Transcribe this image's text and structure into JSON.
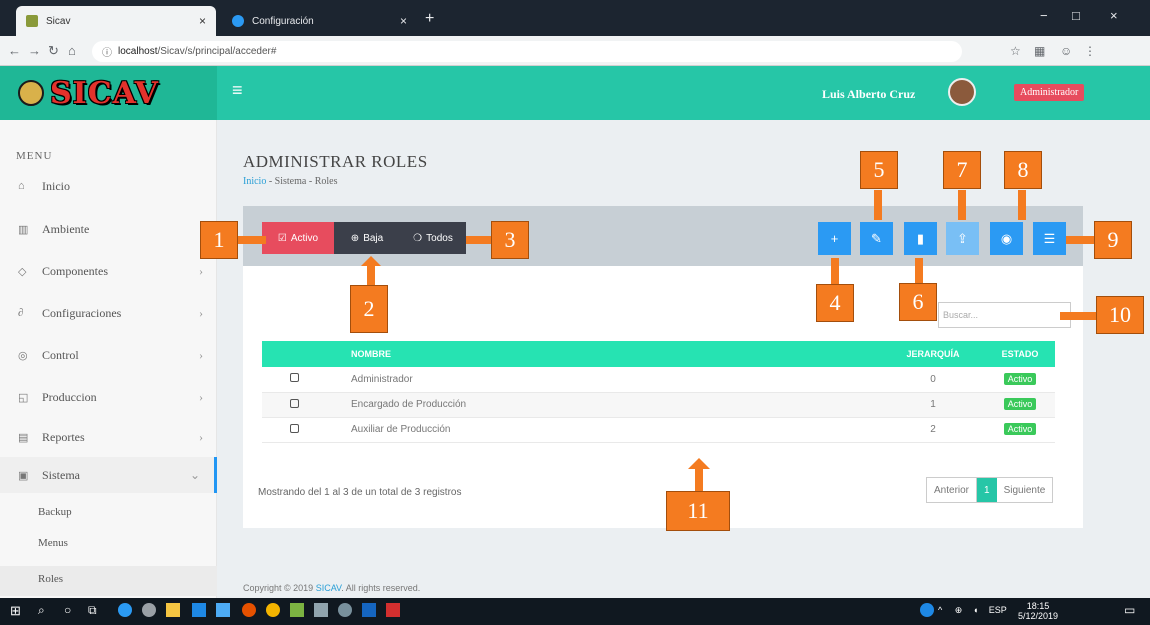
{
  "browser": {
    "tabs": [
      {
        "label": "Sicav",
        "close": "×"
      },
      {
        "label": "Configuración",
        "close": "×"
      }
    ],
    "new_tab": "+",
    "url_prefix": "localhost",
    "url_path": "/Sicav/s/principal/acceder#",
    "window_controls": [
      "−",
      "□",
      "×"
    ]
  },
  "app": {
    "logo_text": "SICAV",
    "user_name": "Luis Alberto Cruz",
    "user_role": "Administrador"
  },
  "sidebar": {
    "title": "MENU",
    "items": [
      {
        "label": "Inicio",
        "icon": "home-icon"
      },
      {
        "label": "Ambiente",
        "icon": "bank-icon"
      },
      {
        "label": "Componentes",
        "icon": "component-icon"
      },
      {
        "label": "Configuraciones",
        "icon": "config-icon"
      },
      {
        "label": "Control",
        "icon": "control-icon"
      },
      {
        "label": "Produccion",
        "icon": "production-icon"
      },
      {
        "label": "Reportes",
        "icon": "report-icon"
      },
      {
        "label": "Sistema",
        "icon": "system-icon"
      }
    ],
    "subitems": [
      "Backup",
      "Menus",
      "Roles"
    ]
  },
  "page": {
    "title": "ADMINISTRAR ROLES",
    "breadcrumb": [
      "Inicio",
      "Sistema",
      "Roles"
    ],
    "breadcrumb_sep": "-",
    "filters": {
      "activo": "Activo",
      "baja": "Baja",
      "todos": "Todos"
    },
    "search_placeholder": "Buscar...",
    "table": {
      "headers": [
        "",
        "NOMBRE",
        "JERARQUÍA",
        "ESTADO"
      ],
      "rows": [
        {
          "name": "Administrador",
          "level": "0",
          "status": "Activo"
        },
        {
          "name": "Encargado de Producción",
          "level": "1",
          "status": "Activo"
        },
        {
          "name": "Auxiliar de Producción",
          "level": "2",
          "status": "Activo"
        }
      ]
    },
    "info": "Mostrando del 1 al 3 de un total de 3 registros",
    "pager": {
      "prev": "Anterior",
      "current": "1",
      "next": "Siguiente"
    },
    "footer_pre": "Copyright © 2019 ",
    "footer_link": "SICAV",
    "footer_post": ". All rights reserved."
  },
  "callouts": [
    "1",
    "2",
    "3",
    "4",
    "5",
    "6",
    "7",
    "8",
    "9",
    "10",
    "11"
  ],
  "taskbar": {
    "lang": "ESP",
    "time": "18:15",
    "date": "5/12/2019"
  },
  "colors": {
    "header": "#26c6a7",
    "logo_bg": "#1fb796",
    "action": "#2b9af3",
    "callout": "#f47b20",
    "table_head": "#26e3b2",
    "danger": "#e74c5e"
  }
}
